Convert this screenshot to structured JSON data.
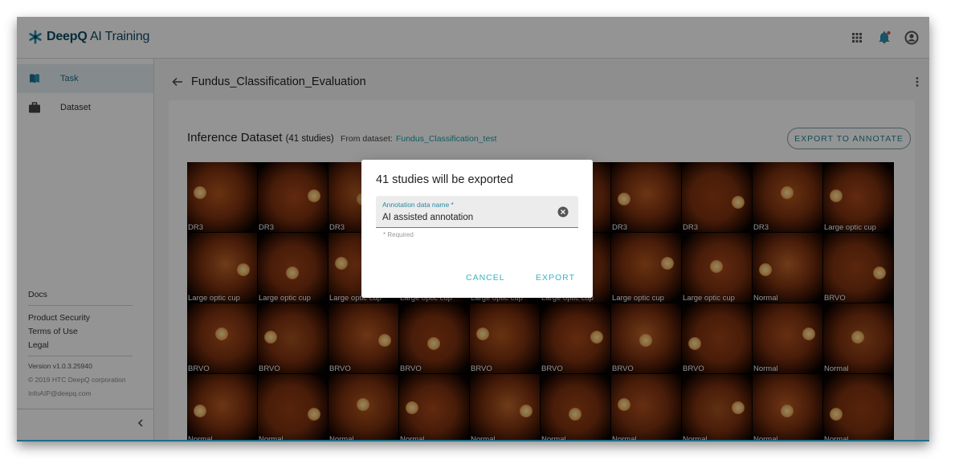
{
  "app": {
    "logo_bold": "DeepQ",
    "logo_rest": " AI Training",
    "accent": "#1f6e8c",
    "teal": "#35b5c2"
  },
  "header": {
    "icons": [
      "apps-grid-icon",
      "notification-bell-icon",
      "account-circle-icon"
    ]
  },
  "sidebar": {
    "items": [
      {
        "label": "Task",
        "icon": "book-icon",
        "active": true
      },
      {
        "label": "Dataset",
        "icon": "briefcase-icon",
        "active": false
      }
    ],
    "docs": "Docs",
    "product_security": "Product Security",
    "terms": "Terms of Use",
    "legal": "Legal",
    "version": "Version v1.0.3.25940",
    "copyright": "© 2019 HTC DeepQ corporation",
    "email": "InfoAIP@deepq.com"
  },
  "page": {
    "title": "Fundus_Classification_Evaluation"
  },
  "dataset": {
    "title": "Inference Dataset",
    "count": "(41 studies)",
    "from_label": "From dataset:",
    "from_link": "Fundus_Classification_test",
    "export_button": "EXPORT TO ANNOTATE"
  },
  "tiles": [
    "DR3",
    "DR3",
    "DR3",
    "",
    "",
    "",
    "DR3",
    "DR3",
    "DR3",
    "Large optic cup",
    "Large optic cup",
    "Large optic cup",
    "Large optic cup",
    "Large optic cup",
    "Large optic cup",
    "Large optic cup",
    "Large optic cup",
    "Large optic cup",
    "Normal",
    "BRVO",
    "BRVO",
    "BRVO",
    "BRVO",
    "BRVO",
    "BRVO",
    "BRVO",
    "BRVO",
    "BRVO",
    "Normal",
    "Normal",
    "Normal",
    "Normal",
    "Normal",
    "Normal",
    "Normal",
    "Normal",
    "Normal",
    "Normal",
    "Normal",
    "Normal"
  ],
  "dialog": {
    "title": "41 studies will be exported",
    "field_label": "Annotation data name *",
    "field_value": "AI assisted annotation",
    "helper": "* Required",
    "cancel": "CANCEL",
    "export": "EXPORT"
  }
}
